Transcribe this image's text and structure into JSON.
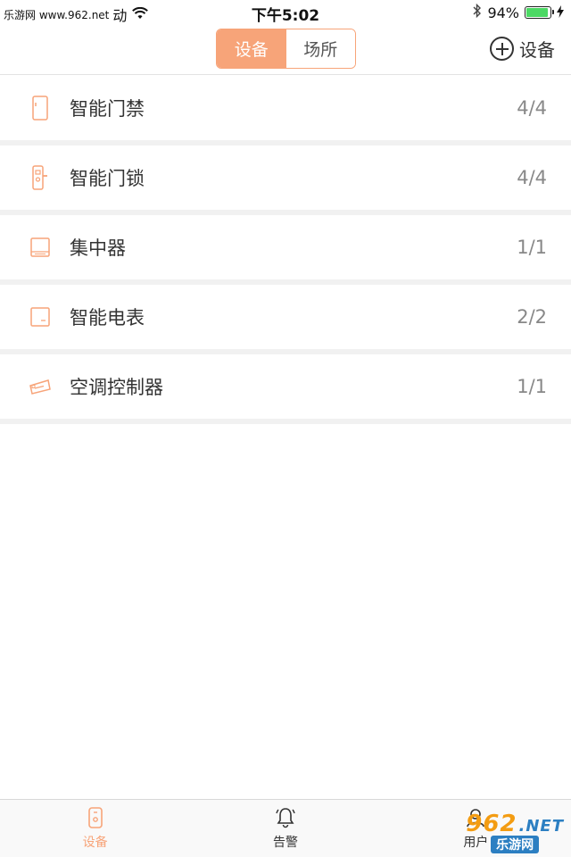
{
  "status_bar": {
    "carrier": "乐游网 www.962.net",
    "activity": "动",
    "time": "下午5:02",
    "battery_percent": "94%"
  },
  "navbar": {
    "segments": [
      {
        "label": "设备",
        "active": true
      },
      {
        "label": "场所",
        "active": false
      }
    ],
    "add_label": "设备"
  },
  "devices": [
    {
      "label": "智能门禁",
      "count": "4/4",
      "icon": "door-access-icon"
    },
    {
      "label": "智能门锁",
      "count": "4/4",
      "icon": "door-lock-icon"
    },
    {
      "label": "集中器",
      "count": "1/1",
      "icon": "concentrator-icon"
    },
    {
      "label": "智能电表",
      "count": "2/2",
      "icon": "meter-icon"
    },
    {
      "label": "空调控制器",
      "count": "1/1",
      "icon": "ac-controller-icon"
    }
  ],
  "tabbar": {
    "tabs": [
      {
        "label": "设备",
        "icon": "device-icon",
        "active": true
      },
      {
        "label": "告警",
        "icon": "bell-icon",
        "active": false
      },
      {
        "label": "用户",
        "icon": "user-icon",
        "active": false
      }
    ]
  },
  "watermark": {
    "logo": "962",
    "domain": ".NET",
    "sub": "乐游网"
  },
  "colors": {
    "accent": "#f7a479",
    "battery": "#4cd964",
    "divider": "#f1f1f1"
  }
}
